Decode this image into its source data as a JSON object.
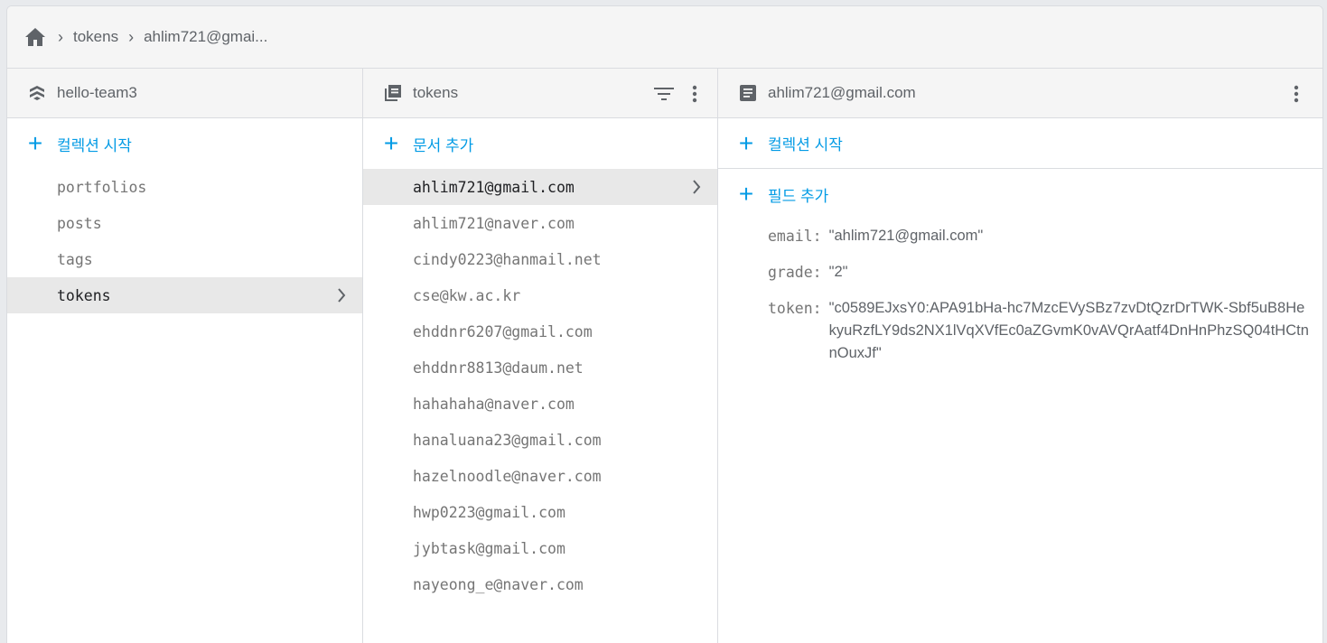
{
  "breadcrumb": {
    "items": [
      "tokens",
      "ahlim721@gmai..."
    ]
  },
  "panel1": {
    "title": "hello-team3",
    "add_label": "컬렉션 시작",
    "items": [
      "portfolios",
      "posts",
      "tags",
      "tokens"
    ],
    "selected_index": 3
  },
  "panel2": {
    "title": "tokens",
    "add_label": "문서 추가",
    "items": [
      "ahlim721@gmail.com",
      "ahlim721@naver.com",
      "cindy0223@hanmail.net",
      "cse@kw.ac.kr",
      "ehddnr6207@gmail.com",
      "ehddnr8813@daum.net",
      "hahahaha@naver.com",
      "hanaluana23@gmail.com",
      "hazelnoodle@naver.com",
      "hwp0223@gmail.com",
      "jybtask@gmail.com",
      "nayeong_e@naver.com"
    ],
    "selected_index": 0
  },
  "panel3": {
    "title": "ahlim721@gmail.com",
    "add_collection_label": "컬렉션 시작",
    "add_field_label": "필드 추가",
    "fields": [
      {
        "key": "email:",
        "value": "\"ahlim721@gmail.com\""
      },
      {
        "key": "grade:",
        "value": "\"2\""
      },
      {
        "key": "token:",
        "value": "\"c0589EJxsY0:APA91bHa-hc7MzcEVySBz7zvDtQzrDrTWK-Sbf5uB8HekyuRzfLY9ds2NX1lVqXVfEc0aZGvmK0vAVQrAatf4DnHnPhzSQ04tHCtnnOuxJf\""
      }
    ]
  },
  "colors": {
    "accent": "#039be5",
    "selected_bg": "#e8e8e8",
    "header_bg": "#f5f5f5"
  }
}
